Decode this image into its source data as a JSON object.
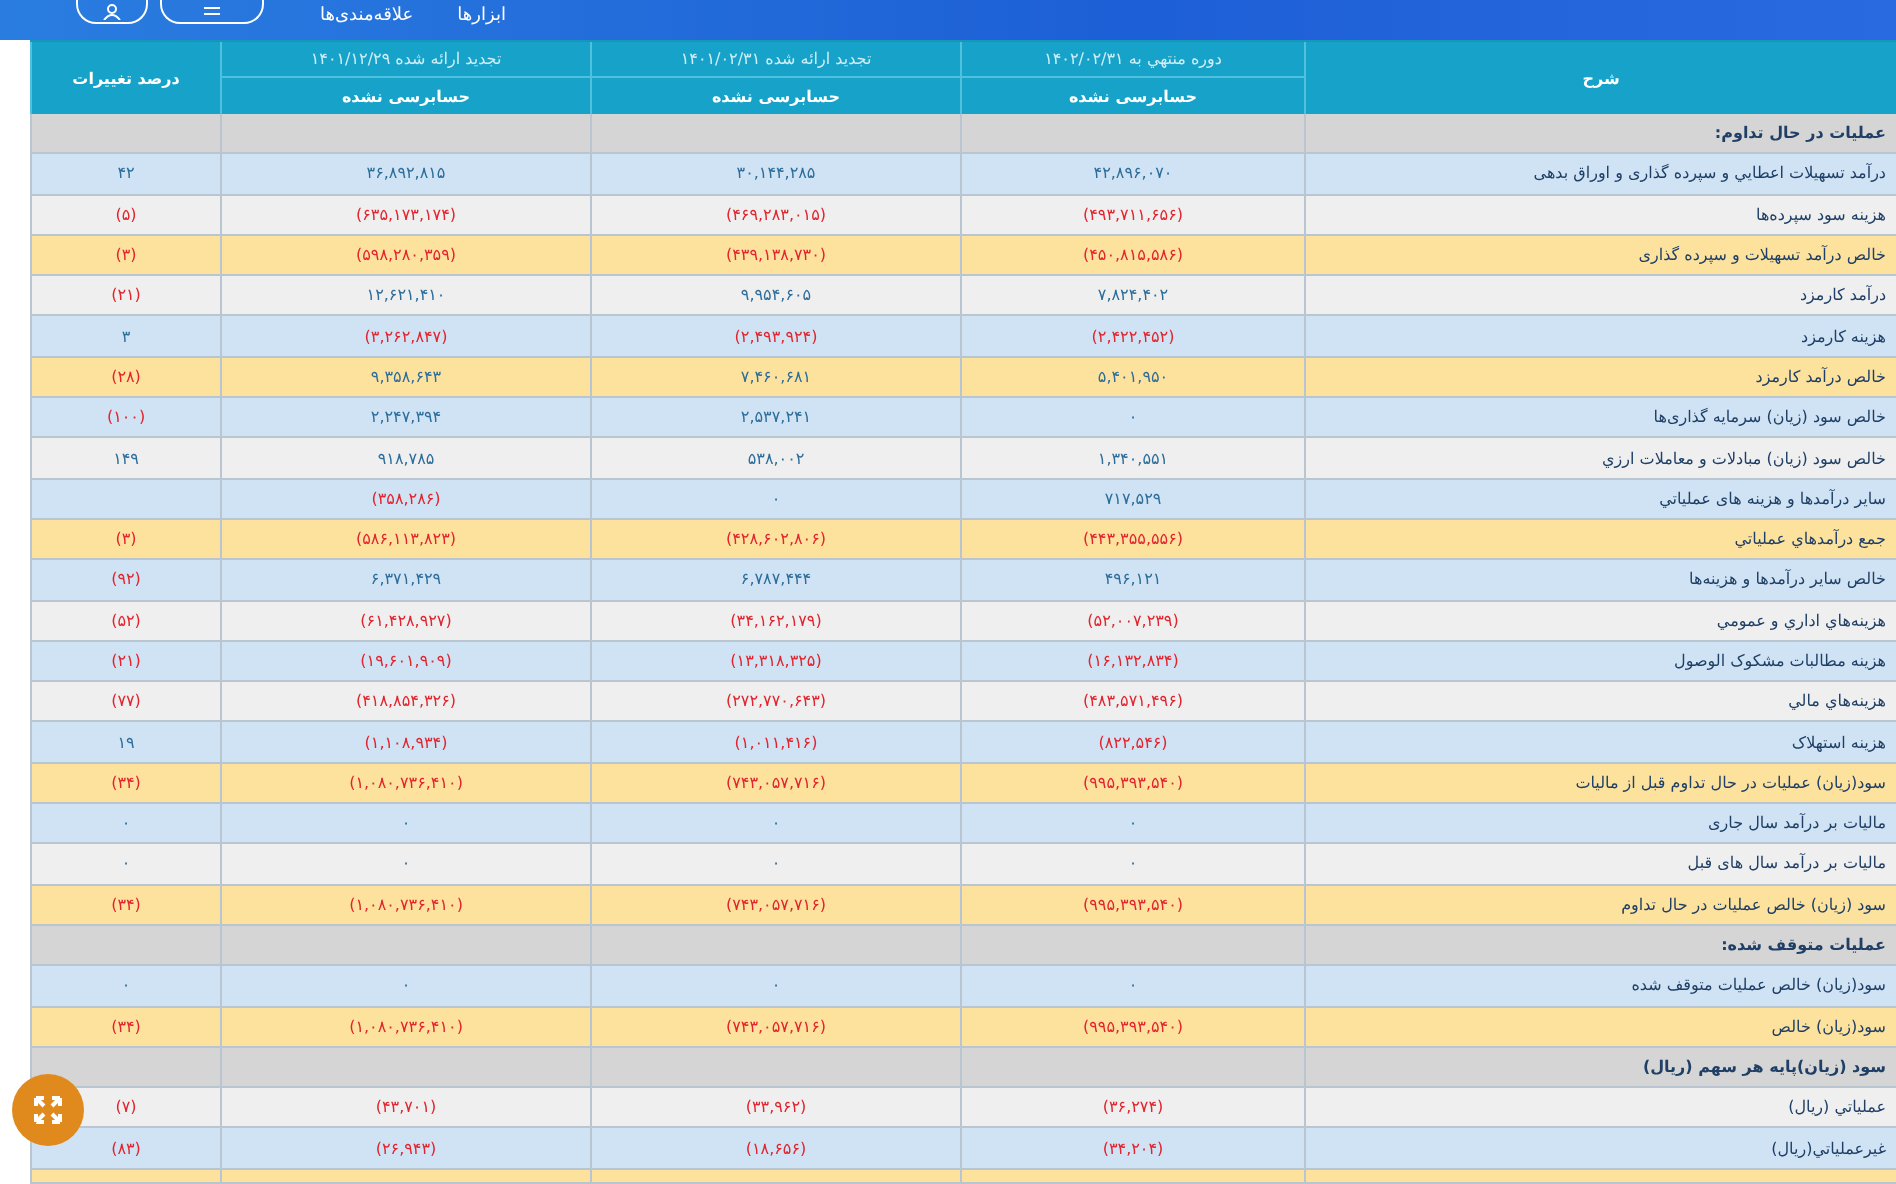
{
  "nav": {
    "items": [
      "ابزارها",
      "علاقه‌مندی‌ها"
    ]
  },
  "table": {
    "description_heading": "شرح",
    "change_heading": "درصد تغییرات",
    "periods": [
      {
        "title": "دوره منتهي به ۱۴۰۲/۰۲/۳۱",
        "audit": "حسابرسی نشده"
      },
      {
        "title": "تجدید ارائه شده ۱۴۰۱/۰۲/۳۱",
        "audit": "حسابرسی نشده"
      },
      {
        "title": "تجدید ارائه شده ۱۴۰۱/۱۲/۲۹",
        "audit": "حسابرسی نشده"
      }
    ],
    "rows": [
      {
        "kind": "section",
        "label": "عملیات در حال تداوم:"
      },
      {
        "kind": "line",
        "label": "درآمد تسهیلات اعطایي و سپرده گذاری و اوراق بدهی",
        "values": [
          {
            "text": "۴۲,۸۹۶,۰۷۰",
            "negative": false
          },
          {
            "text": "۳۰,۱۴۴,۲۸۵",
            "negative": false
          },
          {
            "text": "۳۶,۸۹۲,۸۱۵",
            "negative": false
          },
          {
            "text": "۴۲",
            "negative": false
          }
        ]
      },
      {
        "kind": "stripe",
        "label": "هزینه سود سپرده‌ها",
        "values": [
          {
            "text": "(۴۹۳,۷۱۱,۶۵۶)",
            "negative": true
          },
          {
            "text": "(۴۶۹,۲۸۳,۰۱۵)",
            "negative": true
          },
          {
            "text": "(۶۳۵,۱۷۳,۱۷۴)",
            "negative": true
          },
          {
            "text": "(۵)",
            "negative": true
          }
        ]
      },
      {
        "kind": "total",
        "label": "خالص درآمد تسهیلات و سپرده گذاری",
        "values": [
          {
            "text": "(۴۵۰,۸۱۵,۵۸۶)",
            "negative": true
          },
          {
            "text": "(۴۳۹,۱۳۸,۷۳۰)",
            "negative": true
          },
          {
            "text": "(۵۹۸,۲۸۰,۳۵۹)",
            "negative": true
          },
          {
            "text": "(۳)",
            "negative": true
          }
        ]
      },
      {
        "kind": "stripe",
        "label": "درآمد کارمزد",
        "values": [
          {
            "text": "۷,۸۲۴,۴۰۲",
            "negative": false
          },
          {
            "text": "۹,۹۵۴,۶۰۵",
            "negative": false
          },
          {
            "text": "۱۲,۶۲۱,۴۱۰",
            "negative": false
          },
          {
            "text": "(۲۱)",
            "negative": true
          }
        ]
      },
      {
        "kind": "line",
        "label": "هزینه کارمزد",
        "values": [
          {
            "text": "(۲,۴۲۲,۴۵۲)",
            "negative": true
          },
          {
            "text": "(۲,۴۹۳,۹۲۴)",
            "negative": true
          },
          {
            "text": "(۳,۲۶۲,۸۴۷)",
            "negative": true
          },
          {
            "text": "۳",
            "negative": false
          }
        ]
      },
      {
        "kind": "total",
        "label": "خالص درآمد کارمزد",
        "values": [
          {
            "text": "۵,۴۰۱,۹۵۰",
            "negative": false
          },
          {
            "text": "۷,۴۶۰,۶۸۱",
            "negative": false
          },
          {
            "text": "۹,۳۵۸,۶۴۳",
            "negative": false
          },
          {
            "text": "(۲۸)",
            "negative": true
          }
        ]
      },
      {
        "kind": "line",
        "label": "خالص سود (زیان) سرمایه گذاری‌ها",
        "values": [
          {
            "text": "۰",
            "negative": false
          },
          {
            "text": "۲,۵۳۷,۲۴۱",
            "negative": false
          },
          {
            "text": "۲,۲۴۷,۳۹۴",
            "negative": false
          },
          {
            "text": "(۱۰۰)",
            "negative": true
          }
        ]
      },
      {
        "kind": "stripe",
        "label": "خالص سود (زیان) مبادلات و معاملات ارزي",
        "values": [
          {
            "text": "۱,۳۴۰,۵۵۱",
            "negative": false
          },
          {
            "text": "۵۳۸,۰۰۲",
            "negative": false
          },
          {
            "text": "۹۱۸,۷۸۵",
            "negative": false
          },
          {
            "text": "۱۴۹",
            "negative": false
          }
        ]
      },
      {
        "kind": "line",
        "label": "سایر درآمدها و هزینه های عملیاتي",
        "values": [
          {
            "text": "۷۱۷,۵۲۹",
            "negative": false
          },
          {
            "text": "۰",
            "negative": false
          },
          {
            "text": "(۳۵۸,۲۸۶)",
            "negative": true
          }
        ]
      },
      {
        "kind": "total",
        "label": "جمع درآمدهاي عملیاتي",
        "values": [
          {
            "text": "(۴۴۳,۳۵۵,۵۵۶)",
            "negative": true
          },
          {
            "text": "(۴۲۸,۶۰۲,۸۰۶)",
            "negative": true
          },
          {
            "text": "(۵۸۶,۱۱۳,۸۲۳)",
            "negative": true
          },
          {
            "text": "(۳)",
            "negative": true
          }
        ]
      },
      {
        "kind": "line",
        "label": "خالص سایر درآمدها و هزینه‌ها",
        "values": [
          {
            "text": "۴۹۶,۱۲۱",
            "negative": false
          },
          {
            "text": "۶,۷۸۷,۴۴۴",
            "negative": false
          },
          {
            "text": "۶,۳۷۱,۴۲۹",
            "negative": false
          },
          {
            "text": "(۹۲)",
            "negative": true
          }
        ]
      },
      {
        "kind": "stripe",
        "label": "هزینه‌هاي اداري و عمومي",
        "values": [
          {
            "text": "(۵۲,۰۰۷,۲۳۹)",
            "negative": true
          },
          {
            "text": "(۳۴,۱۶۲,۱۷۹)",
            "negative": true
          },
          {
            "text": "(۶۱,۴۲۸,۹۲۷)",
            "negative": true
          },
          {
            "text": "(۵۲)",
            "negative": true
          }
        ]
      },
      {
        "kind": "line",
        "label": "هزینه مطالبات مشکوک الوصول",
        "values": [
          {
            "text": "(۱۶,۱۳۲,۸۳۴)",
            "negative": true
          },
          {
            "text": "(۱۳,۳۱۸,۳۲۵)",
            "negative": true
          },
          {
            "text": "(۱۹,۶۰۱,۹۰۹)",
            "negative": true
          },
          {
            "text": "(۲۱)",
            "negative": true
          }
        ]
      },
      {
        "kind": "stripe",
        "label": "هزینه‌هاي مالي",
        "values": [
          {
            "text": "(۴۸۳,۵۷۱,۴۹۶)",
            "negative": true
          },
          {
            "text": "(۲۷۲,۷۷۰,۶۴۳)",
            "negative": true
          },
          {
            "text": "(۴۱۸,۸۵۴,۳۲۶)",
            "negative": true
          },
          {
            "text": "(۷۷)",
            "negative": true
          }
        ]
      },
      {
        "kind": "line",
        "label": "هزینه استهلاک",
        "values": [
          {
            "text": "(۸۲۲,۵۴۶)",
            "negative": true
          },
          {
            "text": "(۱,۰۱۱,۴۱۶)",
            "negative": true
          },
          {
            "text": "(۱,۱۰۸,۹۳۴)",
            "negative": true
          },
          {
            "text": "۱۹",
            "negative": false
          }
        ]
      },
      {
        "kind": "total",
        "label": "سود(زیان) عملیات در حال تداوم قبل از مالیات",
        "values": [
          {
            "text": "(۹۹۵,۳۹۳,۵۴۰)",
            "negative": true
          },
          {
            "text": "(۷۴۳,۰۵۷,۷۱۶)",
            "negative": true
          },
          {
            "text": "(۱,۰۸۰,۷۳۶,۴۱۰)",
            "negative": true
          },
          {
            "text": "(۳۴)",
            "negative": true
          }
        ]
      },
      {
        "kind": "line",
        "label": "مالیات بر درآمد سال جاری",
        "values": [
          {
            "text": "۰",
            "negative": false
          },
          {
            "text": "۰",
            "negative": false
          },
          {
            "text": "۰",
            "negative": false
          },
          {
            "text": "۰",
            "negative": false
          }
        ]
      },
      {
        "kind": "stripe",
        "label": "مالیات بر درآمد سال های قبل",
        "values": [
          {
            "text": "۰",
            "negative": false
          },
          {
            "text": "۰",
            "negative": false
          },
          {
            "text": "۰",
            "negative": false
          },
          {
            "text": "۰",
            "negative": false
          }
        ]
      },
      {
        "kind": "total",
        "label": "سود (زیان) خالص عملیات در حال تداوم",
        "values": [
          {
            "text": "(۹۹۵,۳۹۳,۵۴۰)",
            "negative": true
          },
          {
            "text": "(۷۴۳,۰۵۷,۷۱۶)",
            "negative": true
          },
          {
            "text": "(۱,۰۸۰,۷۳۶,۴۱۰)",
            "negative": true
          },
          {
            "text": "(۳۴)",
            "negative": true
          }
        ]
      },
      {
        "kind": "section",
        "label": "عملیات متوقف شده:"
      },
      {
        "kind": "line",
        "label": "سود(زیان) خالص عملیات متوقف شده",
        "values": [
          {
            "text": "۰",
            "negative": false
          },
          {
            "text": "۰",
            "negative": false
          },
          {
            "text": "۰",
            "negative": false
          },
          {
            "text": "۰",
            "negative": false
          }
        ]
      },
      {
        "kind": "total",
        "label": "سود(زیان) خالص",
        "values": [
          {
            "text": "(۹۹۵,۳۹۳,۵۴۰)",
            "negative": true
          },
          {
            "text": "(۷۴۳,۰۵۷,۷۱۶)",
            "negative": true
          },
          {
            "text": "(۱,۰۸۰,۷۳۶,۴۱۰)",
            "negative": true
          },
          {
            "text": "(۳۴)",
            "negative": true
          }
        ]
      },
      {
        "kind": "section",
        "label": "سود (زیان)پایه هر سهم (ریال)"
      },
      {
        "kind": "stripe",
        "label": "عملیاتي (ریال)",
        "values": [
          {
            "text": "(۳۶,۲۷۴)",
            "negative": true
          },
          {
            "text": "(۳۳,۹۶۲)",
            "negative": true
          },
          {
            "text": "(۴۳,۷۰۱)",
            "negative": true
          },
          {
            "text": "(۷)",
            "negative": true
          }
        ]
      },
      {
        "kind": "line",
        "label": "غیرعملیاتي(ریال)",
        "values": [
          {
            "text": "(۳۴,۲۰۴)",
            "negative": true
          },
          {
            "text": "(۱۸,۶۵۶)",
            "negative": true
          },
          {
            "text": "(۲۶,۹۴۳)",
            "negative": true
          },
          {
            "text": "(۸۳)",
            "negative": true
          }
        ]
      }
    ]
  }
}
